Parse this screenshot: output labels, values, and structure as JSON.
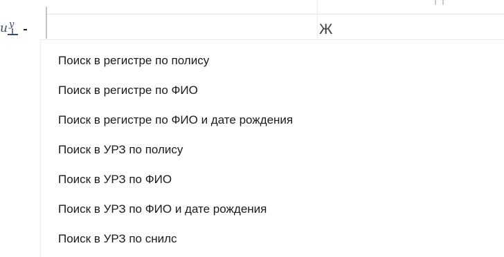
{
  "search_type_button": {
    "icon": "search-mode-icon",
    "arrow_icon": "dropdown-arrow-icon"
  },
  "grid": {
    "gender_value": "Ж"
  },
  "dropdown": {
    "items": [
      {
        "label": "Поиск в регистре по полису"
      },
      {
        "label": "Поиск в регистре по ФИО"
      },
      {
        "label": "Поиск в регистре по ФИО и дате рождения"
      },
      {
        "label": "Поиск в УРЗ по полису"
      },
      {
        "label": "Поиск в УРЗ по ФИО"
      },
      {
        "label": "Поиск в УРЗ по ФИО и дате рождения"
      },
      {
        "label": "Поиск в УРЗ по снилс"
      }
    ]
  }
}
